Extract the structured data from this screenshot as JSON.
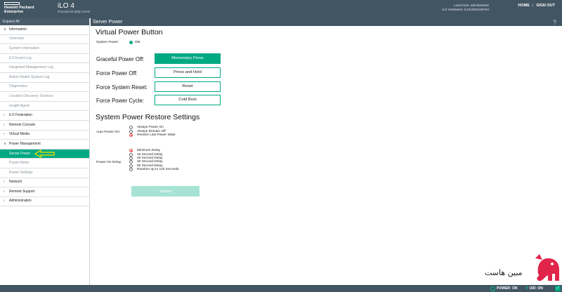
{
  "header": {
    "brand_line1": "Hewlett Packard",
    "brand_line2": "Enterprise",
    "product": "iLO 4",
    "server_model": "ProLiant DL360p Gen8",
    "local_user": "Local User: administrator",
    "ilo_hostname": "iLO Hostname: ILOUSE6115FSH",
    "home_label": "HOME",
    "separator": "|",
    "signout_label": "SIGN OUT"
  },
  "sidebar": {
    "expand_all": "Expand All",
    "information": {
      "label": "Information",
      "chevron": "∨"
    },
    "info_items": [
      "Overview",
      "System Information",
      "iLO Event Log",
      "Integrated Management Log",
      "Active Health System Log",
      "Diagnostics",
      "Location Discovery Services",
      "Insight Agent"
    ],
    "ilo_federation": {
      "label": "iLO Federation",
      "chevron": "›"
    },
    "remote_console": {
      "label": "Remote Console",
      "chevron": "›"
    },
    "virtual_media": {
      "label": "Virtual Media",
      "chevron": "›"
    },
    "power_management": {
      "label": "Power Management",
      "chevron": "∨"
    },
    "power_items": [
      "Server Power",
      "Power Meter",
      "Power Settings"
    ],
    "network": {
      "label": "Network",
      "chevron": "›"
    },
    "remote_support": {
      "label": "Remote Support",
      "chevron": "›"
    },
    "administration": {
      "label": "Administration",
      "chevron": "›"
    },
    "highlight_color": "#01a982",
    "arrow_color": "#f5e100"
  },
  "main": {
    "page_title": "Server Power",
    "help": "?",
    "virtual_power": {
      "title": "Virtual Power Button",
      "system_power_label": "System Power:",
      "system_power_state": "ON",
      "rows": [
        {
          "label": "Graceful Power Off:",
          "button": "Momentary Press"
        },
        {
          "label": "Force Power Off:",
          "button": "Press and Hold"
        },
        {
          "label": "Force System Reset:",
          "button": "Reset"
        },
        {
          "label": "Force Power Cycle:",
          "button": "Cold Boot"
        }
      ]
    },
    "restore": {
      "title": "System Power Restore Settings",
      "auto_power_on_label": "Auto Power-On:",
      "auto_power_on_options": [
        "Always Power On",
        "Always Remain Off",
        "Restore Last Power State"
      ],
      "auto_power_on_selected": 2,
      "power_on_delay_label": "Power-On Delay:",
      "power_on_delay_options": [
        "Minimum Delay",
        "15 Second Delay",
        "30 Second Delay",
        "45 Second Delay",
        "60 Second Delay",
        "Random up to 120 Seconds"
      ],
      "power_on_delay_selected": 0,
      "submit": "Submit"
    }
  },
  "footer": {
    "power": "POWER: ON",
    "uid": "UID: ON",
    "check": "✓"
  },
  "watermark": {
    "text": "مبین هاست"
  }
}
